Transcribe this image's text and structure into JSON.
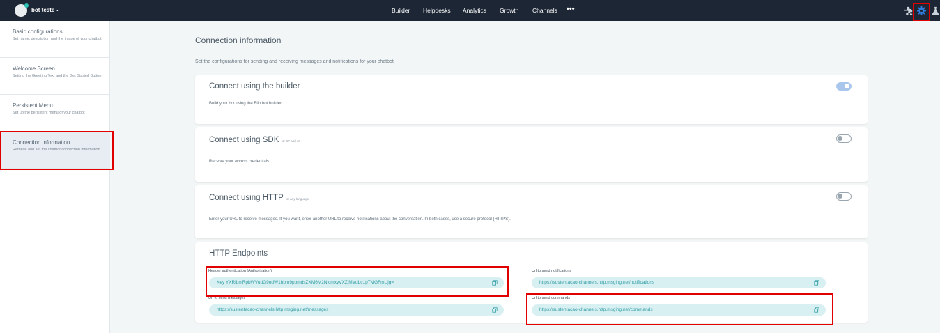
{
  "header": {
    "bot_name": "bot teste",
    "nav": [
      "Builder",
      "Helpdesks",
      "Analytics",
      "Growth",
      "Channels"
    ],
    "more_label": "•••",
    "icons": [
      "extensions-icon",
      "settings-icon",
      "lab-flask-icon"
    ],
    "accent_color": "#2f7de1"
  },
  "sidebar": {
    "items": [
      {
        "title": "Basic configurations",
        "desc": "Set name, description and the image of your chatbot"
      },
      {
        "title": "Welcome Screen",
        "desc": "Setting the Greeting Text and the Get Started Button"
      },
      {
        "title": "Persistent Menu",
        "desc": "Set up the persistent menu of your chatbot"
      },
      {
        "title": "Connection information",
        "desc": "Retrieve and set the chatbot connection information"
      }
    ],
    "active_index": 3
  },
  "main": {
    "title": "Connection information",
    "description": "Set the configurations for sending and receiving messages and notifications for your chatbot",
    "cards": [
      {
        "title": "Connect using the builder",
        "subtitle": "",
        "desc": "Build your bot using the Blip bot builder",
        "enabled": true
      },
      {
        "title": "Connect using SDK",
        "subtitle": "for C# and JS",
        "desc": "Receive your access credentials",
        "enabled": false
      },
      {
        "title": "Connect using HTTP",
        "subtitle": "for any language",
        "desc": "Enter your URL to receive messages. If you want, enter another URL to receive notifications about the conversation. In both cases, use a secure protocol (HTTPS).",
        "enabled": false
      }
    ],
    "endpoints": {
      "title": "HTTP Endpoints",
      "fields": [
        {
          "label": "Header authentication (Authorization)",
          "value": "Key YXRlbmRpbWVudG9odW1hbm9pbmdsZXM6M2NlcmxyVXZjMVdLc1pTMGFmUjg="
        },
        {
          "label": "Url to send notifications",
          "value": "https://sustentacao-channels.http.msging.net/notifications"
        },
        {
          "label": "Url to send messages",
          "value": "https://sustentacao-channels.http.msging.net/messages"
        },
        {
          "label": "Url to send commands",
          "value": "https://sustentacao-channels.http.msging.net/commands"
        }
      ]
    }
  }
}
